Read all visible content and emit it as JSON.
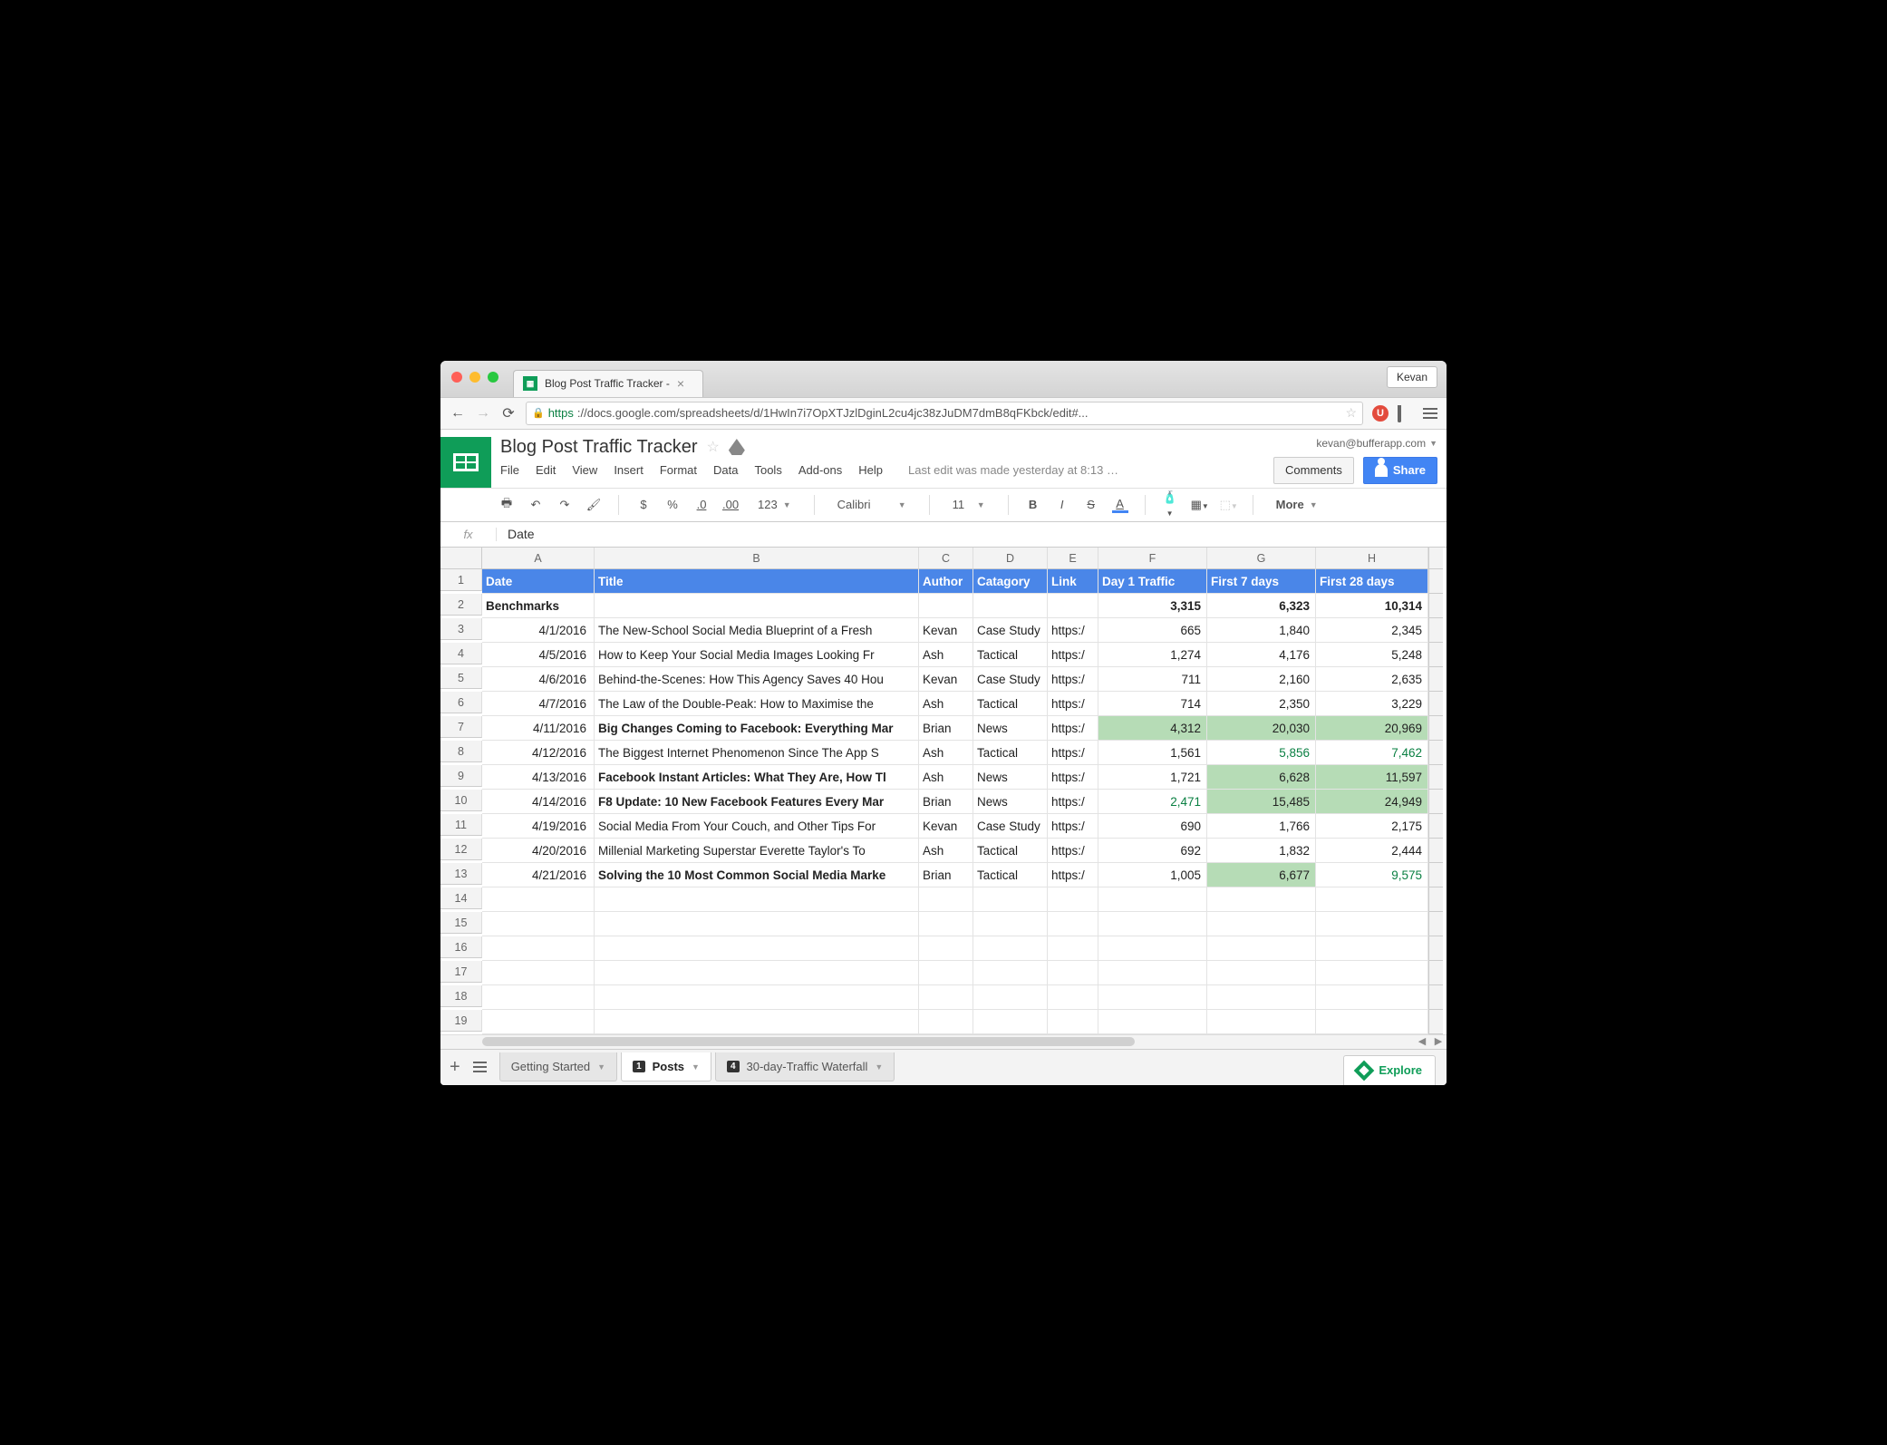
{
  "browser": {
    "tab_title": "Blog Post Traffic Tracker - ",
    "profile": "Kevan",
    "url_scheme": "https",
    "url_rest": "://docs.google.com/spreadsheets/d/1HwIn7i7OpXTJzlDginL2cu4jc38zJuDM7dmB8qFKbck/edit#..."
  },
  "doc": {
    "title": "Blog Post Traffic Tracker",
    "account": "kevan@bufferapp.com",
    "last_edit": "Last edit was made yesterday at 8:13 …",
    "comments_btn": "Comments",
    "share_btn": "Share",
    "menus": [
      "File",
      "Edit",
      "View",
      "Insert",
      "Format",
      "Data",
      "Tools",
      "Add-ons",
      "Help"
    ]
  },
  "toolbar": {
    "currency": "$",
    "percent": "%",
    "dec_dec": ".0",
    "dec_inc": ".00",
    "numfmt": "123",
    "font": "Calibri",
    "size": "11",
    "more": "More"
  },
  "fx": {
    "value": "Date"
  },
  "columns": [
    "A",
    "B",
    "C",
    "D",
    "E",
    "F",
    "G",
    "H"
  ],
  "headers": {
    "A": "Date",
    "B": "Title",
    "C": "Author",
    "D": "Catagory",
    "E": "Link",
    "F": "Day 1 Traffic",
    "G": "First 7 days",
    "H": "First 28 days"
  },
  "benchmarks": {
    "label": "Benchmarks",
    "F": "3,315",
    "G": "6,323",
    "H": "10,314"
  },
  "rows": [
    {
      "r": 3,
      "date": "4/1/2016",
      "title": "The New-School Social Media Blueprint of a Fresh",
      "author": "Kevan",
      "cat": "Case Study",
      "link": "https:/",
      "f": "665",
      "g": "1,840",
      "h": "2,345"
    },
    {
      "r": 4,
      "date": "4/5/2016",
      "title": "How to Keep Your Social Media Images Looking Fr",
      "author": "Ash",
      "cat": "Tactical",
      "link": "https:/",
      "f": "1,274",
      "g": "4,176",
      "h": "5,248"
    },
    {
      "r": 5,
      "date": "4/6/2016",
      "title": "Behind-the-Scenes: How This Agency Saves 40 Hou",
      "author": "Kevan",
      "cat": "Case Study",
      "link": "https:/",
      "f": "711",
      "g": "2,160",
      "h": "2,635"
    },
    {
      "r": 6,
      "date": "4/7/2016",
      "title": "The Law of the Double-Peak: How to Maximise the",
      "author": "Ash",
      "cat": "Tactical",
      "link": "https:/",
      "f": "714",
      "g": "2,350",
      "h": "3,229"
    },
    {
      "r": 7,
      "date": "4/11/2016",
      "title": "Big Changes Coming to Facebook: Everything Mar",
      "author": "Brian",
      "cat": "News",
      "link": "https:/",
      "f": "4,312",
      "g": "20,030",
      "h": "20,969",
      "bold": true,
      "hl": {
        "f": true,
        "g": true,
        "h": true
      }
    },
    {
      "r": 8,
      "date": "4/12/2016",
      "title": "The Biggest Internet Phenomenon Since The App S",
      "author": "Ash",
      "cat": "Tactical",
      "link": "https:/",
      "f": "1,561",
      "g": "5,856",
      "h": "7,462",
      "tg": {
        "g": true,
        "h": true
      }
    },
    {
      "r": 9,
      "date": "4/13/2016",
      "title": "Facebook Instant Articles: What They Are, How Tl",
      "author": "Ash",
      "cat": "News",
      "link": "https:/",
      "f": "1,721",
      "g": "6,628",
      "h": "11,597",
      "bold": true,
      "hl": {
        "g": true,
        "h": true
      }
    },
    {
      "r": 10,
      "date": "4/14/2016",
      "title": "F8 Update: 10 New Facebook Features Every Mar",
      "author": "Brian",
      "cat": "News",
      "link": "https:/",
      "f": "2,471",
      "g": "15,485",
      "h": "24,949",
      "bold": true,
      "hl": {
        "g": true,
        "h": true
      },
      "tg": {
        "f": true
      }
    },
    {
      "r": 11,
      "date": "4/19/2016",
      "title": "Social Media From Your Couch, and Other Tips For",
      "author": "Kevan",
      "cat": "Case Study",
      "link": "https:/",
      "f": "690",
      "g": "1,766",
      "h": "2,175"
    },
    {
      "r": 12,
      "date": "4/20/2016",
      "title": "Millenial Marketing Superstar Everette Taylor's To",
      "author": "Ash",
      "cat": "Tactical",
      "link": "https:/",
      "f": "692",
      "g": "1,832",
      "h": "2,444"
    },
    {
      "r": 13,
      "date": "4/21/2016",
      "title": "Solving the 10 Most Common Social Media Marke",
      "author": "Brian",
      "cat": "Tactical",
      "link": "https:/",
      "f": "1,005",
      "g": "6,677",
      "h": "9,575",
      "bold": true,
      "hl": {
        "g": true
      },
      "tg": {
        "h": true
      }
    }
  ],
  "empty_rows": [
    14,
    15,
    16,
    17,
    18,
    19
  ],
  "sheets": {
    "tabs": [
      {
        "label": "Getting Started",
        "badge": null,
        "active": false
      },
      {
        "label": "Posts",
        "badge": "1",
        "active": true
      },
      {
        "label": "30-day-Traffic Waterfall",
        "badge": "4",
        "active": false
      }
    ],
    "explore": "Explore"
  }
}
